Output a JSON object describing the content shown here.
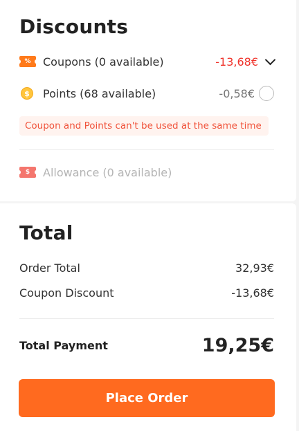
{
  "discounts": {
    "title": "Discounts",
    "coupons": {
      "icon_text": "%",
      "label": "Coupons (0 available)",
      "value": "-13,68€",
      "color": "#f0332b"
    },
    "points": {
      "icon_text": "$",
      "label": "Points (68 available)",
      "value": "-0,58€"
    },
    "warning": "Coupon and Points can't be used at the same time",
    "allowance": {
      "icon_text": "$",
      "label": "Allowance (0 available)"
    }
  },
  "total": {
    "title": "Total",
    "order_total_label": "Order Total",
    "order_total_value": "32,93€",
    "coupon_discount_label": "Coupon Discount",
    "coupon_discount_value": "-13,68€",
    "payment_label": "Total Payment",
    "payment_value": "19,25€"
  },
  "place_order": {
    "label": "Place Order",
    "color": "#ff6a1f"
  }
}
